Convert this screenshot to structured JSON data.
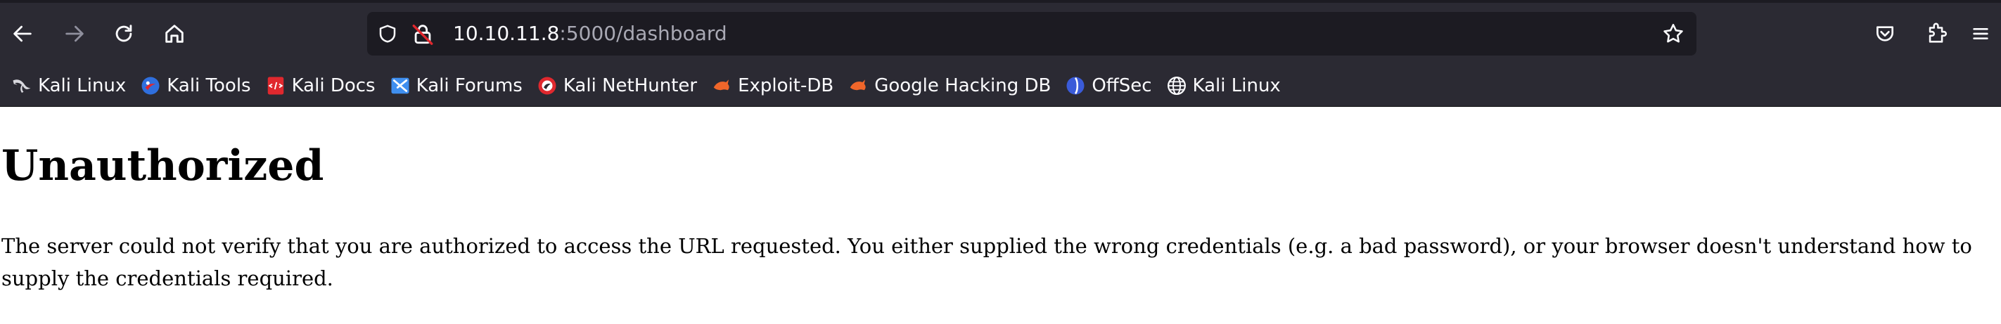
{
  "browser": {
    "url_host": "10.10.11.8",
    "url_rest": ":5000/dashboard"
  },
  "icons": {
    "back": "back-arrow-icon",
    "forward": "forward-arrow-icon",
    "reload": "reload-icon",
    "home": "home-icon",
    "tracking": "shield-icon",
    "insecure": "insecure-lock-icon",
    "bookmark": "star-icon",
    "pocket": "pocket-icon",
    "extensions": "extensions-icon",
    "menu": "hamburger-menu-icon"
  },
  "bookmarks": [
    {
      "label": "Kali Linux",
      "icon": "kali-dragon-icon"
    },
    {
      "label": "Kali Tools",
      "icon": "kali-tools-icon"
    },
    {
      "label": "Kali Docs",
      "icon": "kali-docs-icon"
    },
    {
      "label": "Kali Forums",
      "icon": "kali-forums-icon"
    },
    {
      "label": "Kali NetHunter",
      "icon": "nethunter-icon"
    },
    {
      "label": "Exploit-DB",
      "icon": "exploit-db-icon"
    },
    {
      "label": "Google Hacking DB",
      "icon": "ghdb-icon"
    },
    {
      "label": "OffSec",
      "icon": "offsec-icon"
    },
    {
      "label": "Kali Linux",
      "icon": "globe-icon"
    }
  ],
  "page": {
    "title": "Unauthorized",
    "message": "The server could not verify that you are authorized to access the URL requested. You either supplied the wrong credentials (e.g. a bad password), or your browser doesn't understand how to supply the credentials required."
  },
  "colors": {
    "chrome_bg": "#2b2a33",
    "urlbar_bg": "#1c1b22",
    "text_light": "#fbfbfe",
    "accent_red": "#e0282e"
  }
}
